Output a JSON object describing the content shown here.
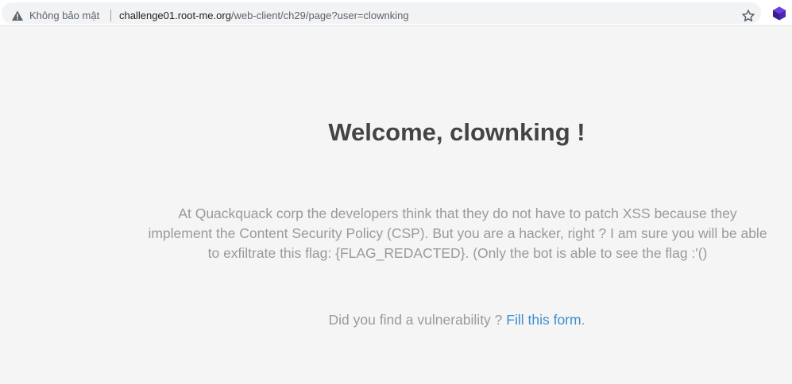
{
  "browser": {
    "security_label": "Không bảo mật",
    "url_host": "challenge01.root-me.org",
    "url_path": "/web-client/ch29/page?user=clownking",
    "star_icon": "bookmark-star-icon",
    "extension_icon": "extension-icon",
    "warning_icon": "warning-triangle-icon",
    "accent_color": "#5b2bd6"
  },
  "page": {
    "heading": "Welcome, clownking !",
    "description": "At Quackquack corp the developers think that they do not have to patch XSS because they implement the Content Security Policy (CSP). But you are a hacker, right ? I am sure you will be able to exfiltrate this flag: {FLAG_REDACTED}. (Only the bot is able to see the flag :'()",
    "question_prefix": "Did you find a vulnerability ? ",
    "form_link_label": "Fill this form",
    "question_suffix": ".",
    "text_color": "#9a9a9a",
    "heading_color": "#444444",
    "link_color": "#3d8ecf"
  }
}
